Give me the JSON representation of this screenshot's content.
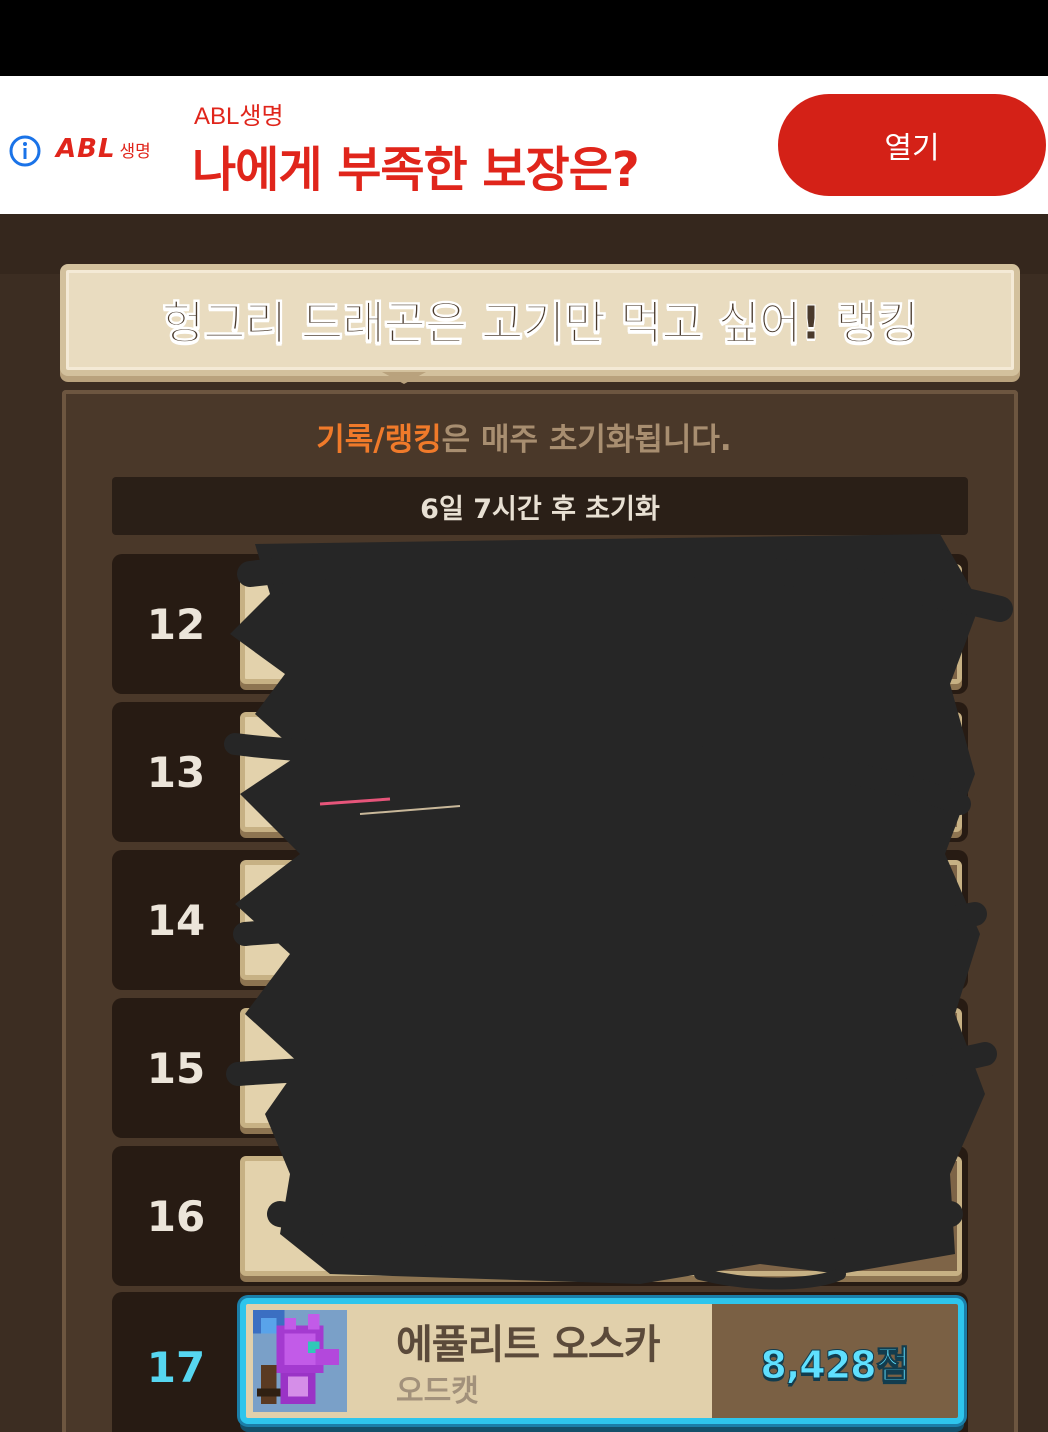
{
  "ad": {
    "logo_main": "ABL",
    "logo_sub": "생명",
    "advertiser": "ABL생명",
    "headline": "나에게 부족한 보장은?",
    "open_label": "열기",
    "info_icon": "info-icon",
    "close_icon": "close-icon",
    "colors": {
      "brand": "#e0251b",
      "button": "#d42117"
    }
  },
  "game": {
    "title": "헝그리 드래곤은 고기만 먹고 싶어! 랭킹",
    "notice_highlight": "기록/랭킹",
    "notice_rest": "은 매주 초기화됩니다.",
    "reset_text": "6일 7시간 후 초기화",
    "ranks": [
      {
        "rank": "12"
      },
      {
        "rank": "13"
      },
      {
        "rank": "14"
      },
      {
        "rank": "15"
      },
      {
        "rank": "16"
      }
    ],
    "my_entry": {
      "rank": "17",
      "name": "에퓰리트 오스카",
      "subtitle": "오드캣",
      "score": "8,428점",
      "avatar_icon": "purple-dragon-icon"
    },
    "colors": {
      "highlight": "#f07a2a",
      "my_rank": "#56d6f0",
      "my_border": "#2ec5ec"
    }
  }
}
